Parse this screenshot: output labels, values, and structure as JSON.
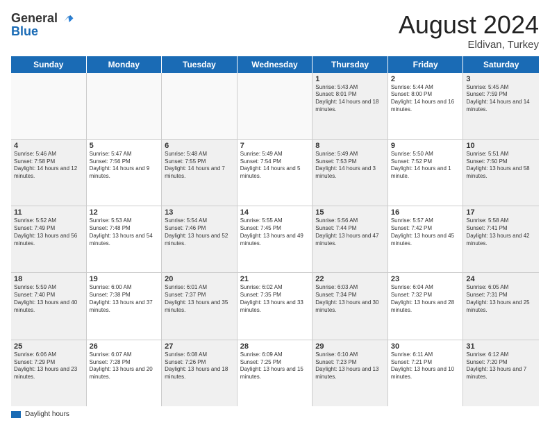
{
  "header": {
    "logo_general": "General",
    "logo_blue": "Blue",
    "month_title": "August 2024",
    "location": "Eldivan, Turkey"
  },
  "days_of_week": [
    "Sunday",
    "Monday",
    "Tuesday",
    "Wednesday",
    "Thursday",
    "Friday",
    "Saturday"
  ],
  "legend": {
    "label": "Daylight hours"
  },
  "weeks": [
    [
      {
        "day": "",
        "empty": true
      },
      {
        "day": "",
        "empty": true
      },
      {
        "day": "",
        "empty": true
      },
      {
        "day": "",
        "empty": true
      },
      {
        "day": "1",
        "sunrise": "5:43 AM",
        "sunset": "8:01 PM",
        "daylight": "14 hours and 18 minutes."
      },
      {
        "day": "2",
        "sunrise": "5:44 AM",
        "sunset": "8:00 PM",
        "daylight": "14 hours and 16 minutes."
      },
      {
        "day": "3",
        "sunrise": "5:45 AM",
        "sunset": "7:59 PM",
        "daylight": "14 hours and 14 minutes."
      }
    ],
    [
      {
        "day": "4",
        "sunrise": "5:46 AM",
        "sunset": "7:58 PM",
        "daylight": "14 hours and 12 minutes."
      },
      {
        "day": "5",
        "sunrise": "5:47 AM",
        "sunset": "7:56 PM",
        "daylight": "14 hours and 9 minutes."
      },
      {
        "day": "6",
        "sunrise": "5:48 AM",
        "sunset": "7:55 PM",
        "daylight": "14 hours and 7 minutes."
      },
      {
        "day": "7",
        "sunrise": "5:49 AM",
        "sunset": "7:54 PM",
        "daylight": "14 hours and 5 minutes."
      },
      {
        "day": "8",
        "sunrise": "5:49 AM",
        "sunset": "7:53 PM",
        "daylight": "14 hours and 3 minutes."
      },
      {
        "day": "9",
        "sunrise": "5:50 AM",
        "sunset": "7:52 PM",
        "daylight": "14 hours and 1 minute."
      },
      {
        "day": "10",
        "sunrise": "5:51 AM",
        "sunset": "7:50 PM",
        "daylight": "13 hours and 58 minutes."
      }
    ],
    [
      {
        "day": "11",
        "sunrise": "5:52 AM",
        "sunset": "7:49 PM",
        "daylight": "13 hours and 56 minutes."
      },
      {
        "day": "12",
        "sunrise": "5:53 AM",
        "sunset": "7:48 PM",
        "daylight": "13 hours and 54 minutes."
      },
      {
        "day": "13",
        "sunrise": "5:54 AM",
        "sunset": "7:46 PM",
        "daylight": "13 hours and 52 minutes."
      },
      {
        "day": "14",
        "sunrise": "5:55 AM",
        "sunset": "7:45 PM",
        "daylight": "13 hours and 49 minutes."
      },
      {
        "day": "15",
        "sunrise": "5:56 AM",
        "sunset": "7:44 PM",
        "daylight": "13 hours and 47 minutes."
      },
      {
        "day": "16",
        "sunrise": "5:57 AM",
        "sunset": "7:42 PM",
        "daylight": "13 hours and 45 minutes."
      },
      {
        "day": "17",
        "sunrise": "5:58 AM",
        "sunset": "7:41 PM",
        "daylight": "13 hours and 42 minutes."
      }
    ],
    [
      {
        "day": "18",
        "sunrise": "5:59 AM",
        "sunset": "7:40 PM",
        "daylight": "13 hours and 40 minutes."
      },
      {
        "day": "19",
        "sunrise": "6:00 AM",
        "sunset": "7:38 PM",
        "daylight": "13 hours and 37 minutes."
      },
      {
        "day": "20",
        "sunrise": "6:01 AM",
        "sunset": "7:37 PM",
        "daylight": "13 hours and 35 minutes."
      },
      {
        "day": "21",
        "sunrise": "6:02 AM",
        "sunset": "7:35 PM",
        "daylight": "13 hours and 33 minutes."
      },
      {
        "day": "22",
        "sunrise": "6:03 AM",
        "sunset": "7:34 PM",
        "daylight": "13 hours and 30 minutes."
      },
      {
        "day": "23",
        "sunrise": "6:04 AM",
        "sunset": "7:32 PM",
        "daylight": "13 hours and 28 minutes."
      },
      {
        "day": "24",
        "sunrise": "6:05 AM",
        "sunset": "7:31 PM",
        "daylight": "13 hours and 25 minutes."
      }
    ],
    [
      {
        "day": "25",
        "sunrise": "6:06 AM",
        "sunset": "7:29 PM",
        "daylight": "13 hours and 23 minutes."
      },
      {
        "day": "26",
        "sunrise": "6:07 AM",
        "sunset": "7:28 PM",
        "daylight": "13 hours and 20 minutes."
      },
      {
        "day": "27",
        "sunrise": "6:08 AM",
        "sunset": "7:26 PM",
        "daylight": "13 hours and 18 minutes."
      },
      {
        "day": "28",
        "sunrise": "6:09 AM",
        "sunset": "7:25 PM",
        "daylight": "13 hours and 15 minutes."
      },
      {
        "day": "29",
        "sunrise": "6:10 AM",
        "sunset": "7:23 PM",
        "daylight": "13 hours and 13 minutes."
      },
      {
        "day": "30",
        "sunrise": "6:11 AM",
        "sunset": "7:21 PM",
        "daylight": "13 hours and 10 minutes."
      },
      {
        "day": "31",
        "sunrise": "6:12 AM",
        "sunset": "7:20 PM",
        "daylight": "13 hours and 7 minutes."
      }
    ]
  ]
}
